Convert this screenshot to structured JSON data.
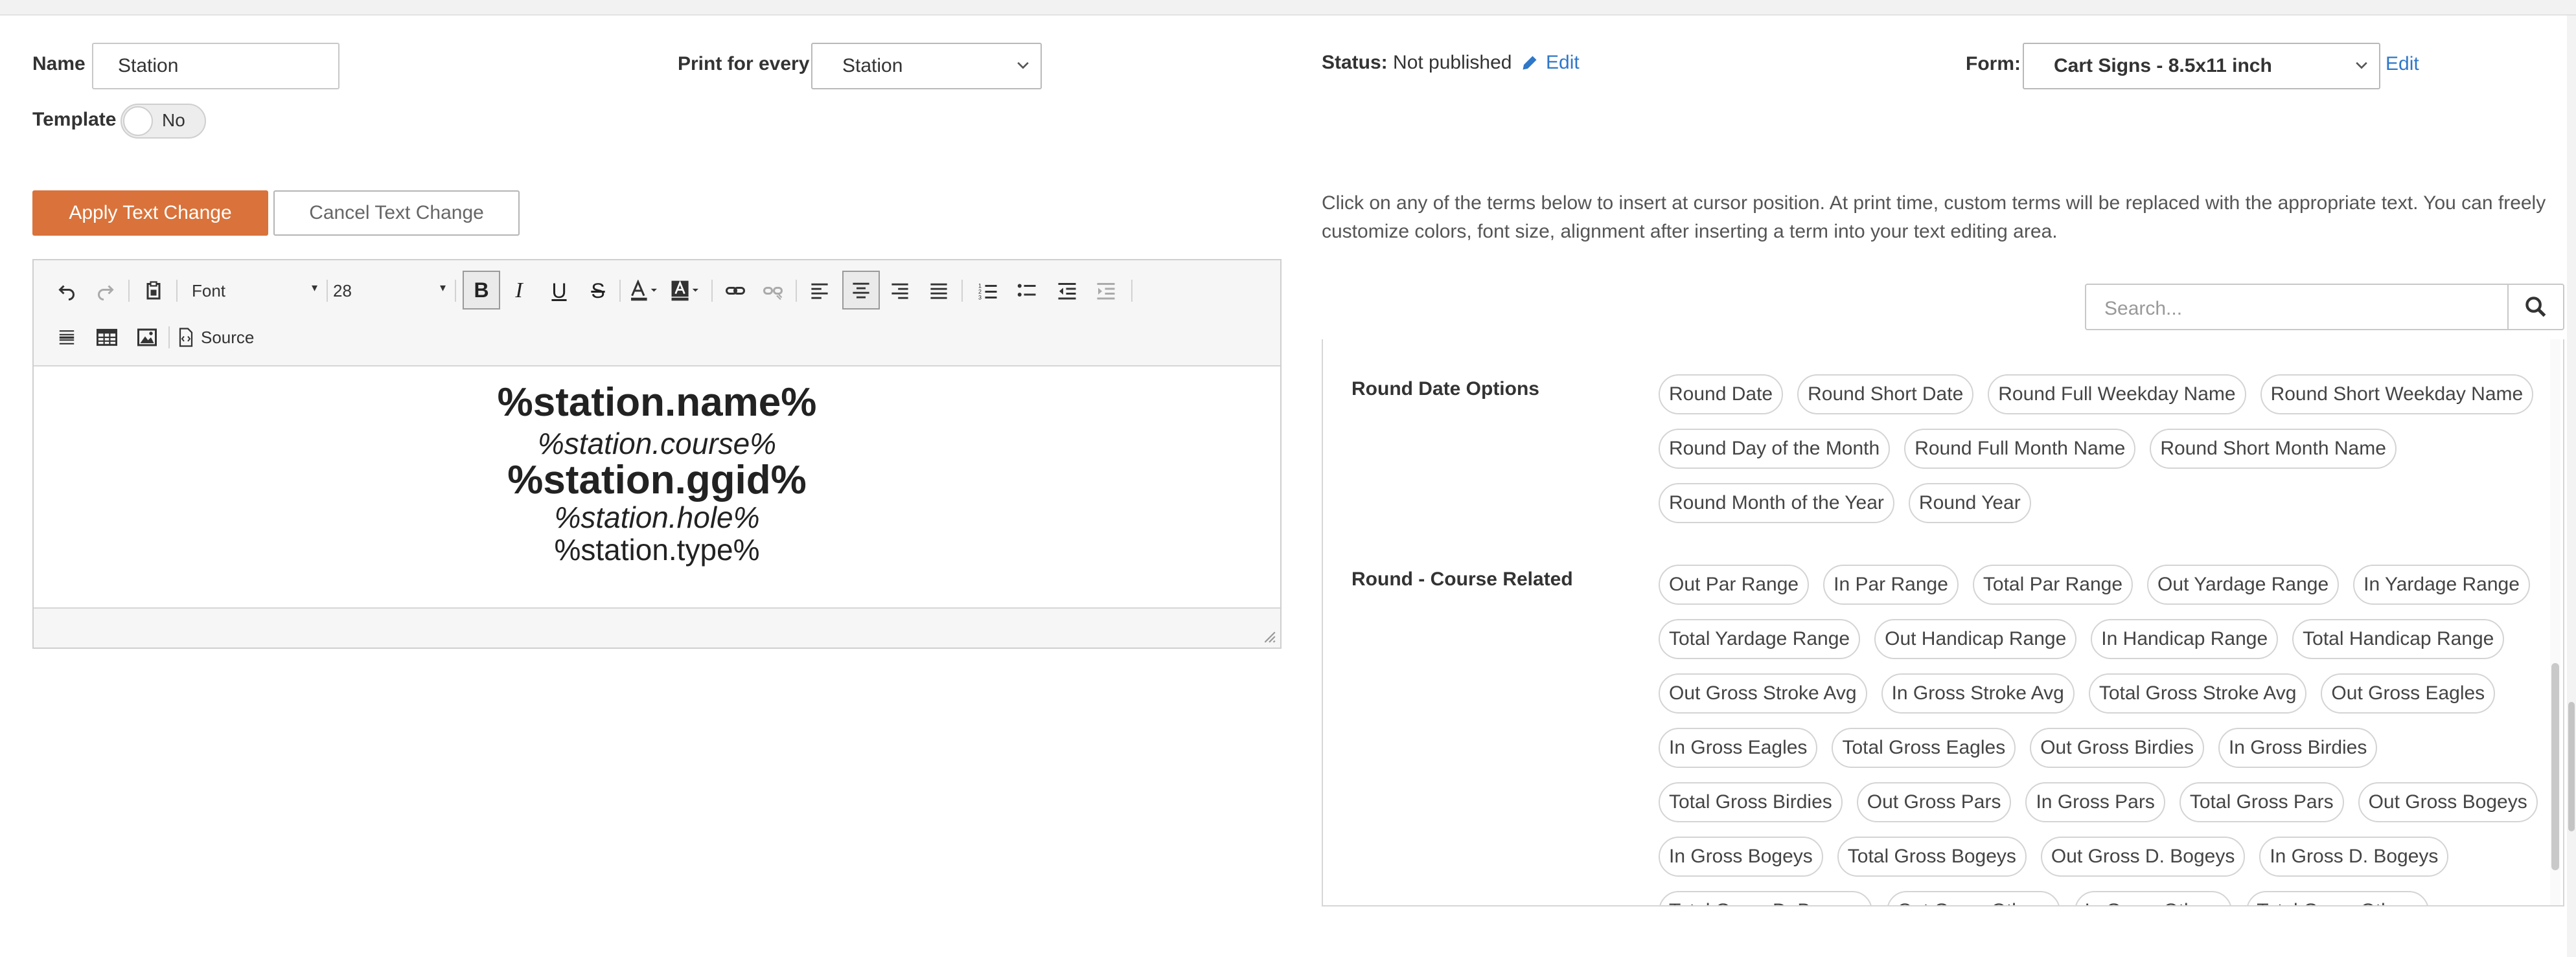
{
  "header": {
    "name_label": "Name",
    "name_value": "Station",
    "print_label": "Print for every",
    "print_value": "Station",
    "template_label": "Template",
    "template_toggle": "No",
    "status_label": "Status:",
    "status_value": "Not published",
    "status_edit": "Edit",
    "form_label": "Form:",
    "form_value": "Cart Signs - 8.5x11 inch",
    "form_edit": "Edit"
  },
  "actions": {
    "apply": "Apply Text Change",
    "cancel": "Cancel Text Change"
  },
  "editor": {
    "font_select": "Font",
    "size_select": "28",
    "source_label": "Source",
    "lines": [
      "%station.name%",
      "%station.course%",
      "%station.ggid%",
      "%station.hole%",
      "%station.type%"
    ]
  },
  "terms_panel": {
    "instructions": "Click on any of the terms below to insert at cursor position. At print time, custom terms will be replaced with the appropriate text. You can freely customize colors, font size, alignment after inserting a term into your text editing area.",
    "search_placeholder": "Search...",
    "groups": [
      {
        "title": "Round Date Options",
        "terms": [
          "Round Date",
          "Round Short Date",
          "Round Full Weekday Name",
          "Round Short Weekday Name",
          "Round Day of the Month",
          "Round Full Month Name",
          "Round Short Month Name",
          "Round Month of the Year",
          "Round Year"
        ]
      },
      {
        "title": "Round - Course Related",
        "terms": [
          "Out Par Range",
          "In Par Range",
          "Total Par Range",
          "Out Yardage Range",
          "In Yardage Range",
          "Total Yardage Range",
          "Out Handicap Range",
          "In Handicap Range",
          "Total Handicap Range",
          "Out Gross Stroke Avg",
          "In Gross Stroke Avg",
          "Total Gross Stroke Avg",
          "Out Gross Eagles",
          "In Gross Eagles",
          "Total Gross Eagles",
          "Out Gross Birdies",
          "In Gross Birdies",
          "Total Gross Birdies",
          "Out Gross Pars",
          "In Gross Pars",
          "Total Gross Pars",
          "Out Gross Bogeys",
          "In Gross Bogeys",
          "Total Gross Bogeys",
          "Out Gross D. Bogeys",
          "In Gross D. Bogeys",
          "Total Gross D. Bogeys",
          "Out Gross Others",
          "In Gross Others",
          "Total Gross Others"
        ]
      }
    ]
  },
  "colors": {
    "primary_button": "#d9733b",
    "link": "#2f77c8"
  }
}
